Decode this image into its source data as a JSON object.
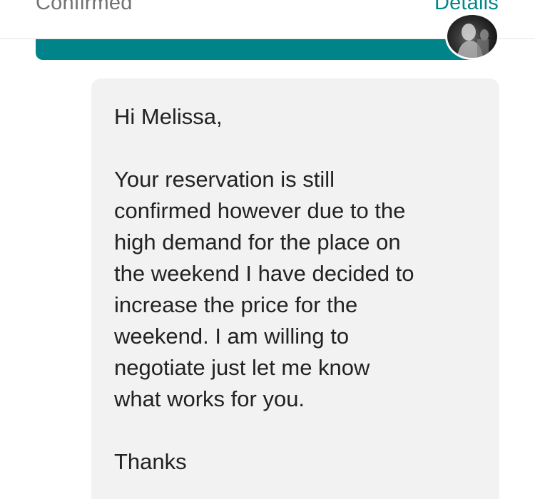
{
  "header": {
    "status": "Confirmed",
    "details_link": "Details"
  },
  "message": {
    "greeting": "Hi Melissa,",
    "body_lines": [
      "Your reservation is still",
      "confirmed however due to the",
      "high demand for the place on",
      "the weekend I have decided to",
      "increase the price for the",
      "weekend. I am willing to",
      "negotiate just let me know",
      "what works for you."
    ],
    "closing": "Thanks"
  },
  "colors": {
    "accent": "#008489",
    "bubble": "#f2f2f2",
    "text": "#222222",
    "muted": "#717171"
  }
}
